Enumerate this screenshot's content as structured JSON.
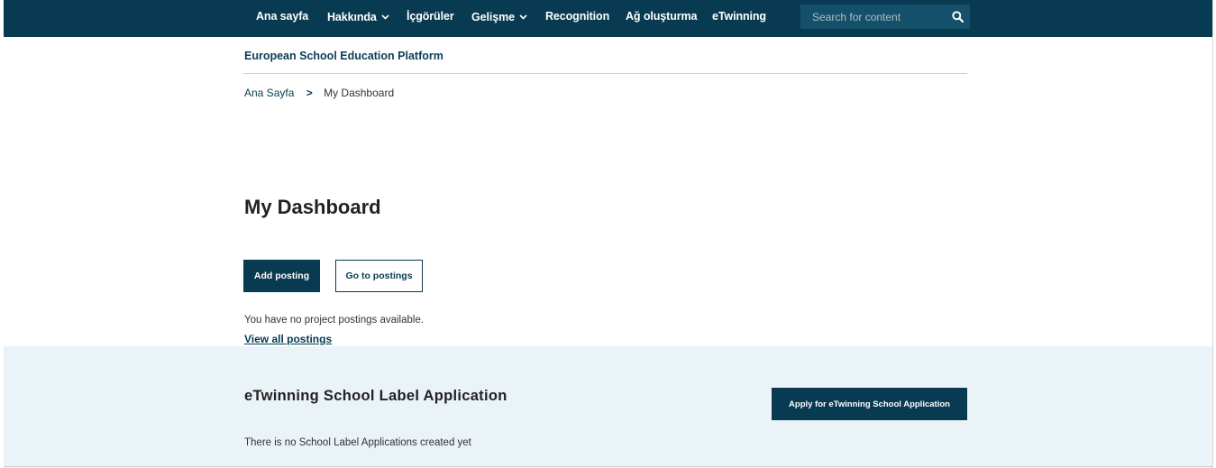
{
  "nav": {
    "items": [
      {
        "label": "Ana sayfa",
        "dropdown": false
      },
      {
        "label": "Hakkında",
        "dropdown": true
      },
      {
        "label": "İçgörüler",
        "dropdown": false
      },
      {
        "label": "Gelişme",
        "dropdown": true
      },
      {
        "label": "Recognition",
        "dropdown": false
      },
      {
        "label": "Ağ oluşturma",
        "dropdown": false
      },
      {
        "label": "eTwinning",
        "dropdown": false
      }
    ],
    "search_placeholder": "Search for content",
    "search_icon": "search-icon"
  },
  "header": {
    "platform_title": "European School Education Platform"
  },
  "breadcrumb": {
    "home": "Ana Sayfa",
    "separator": ">",
    "current": "My Dashboard"
  },
  "main": {
    "title": "My Dashboard",
    "add_posting": "Add posting",
    "go_to_postings": "Go to postings",
    "no_postings": "You have no project postings available.",
    "view_all": "View all postings"
  },
  "label_section": {
    "title": "eTwinning School Label Application",
    "apply_button": "Apply for eTwinning School Application",
    "empty_text": "There is no School Label Applications created yet"
  },
  "colors": {
    "brand": "#083b52",
    "section_bg": "#eaf3f7"
  }
}
